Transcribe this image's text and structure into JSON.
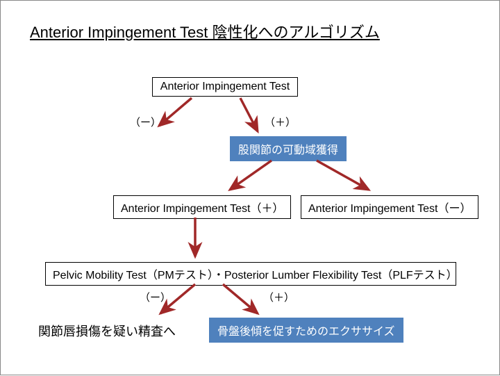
{
  "title": "Anterior Impingement Test   陰性化へのアルゴリズム",
  "nodes": {
    "n1": "Anterior Impingement Test",
    "n2": "股関節の可動域獲得",
    "n3": "Anterior Impingement Test（＋）",
    "n4": "Anterior Impingement Test（ー）",
    "n5": "Pelvic Mobility Test（PMテスト）・Posterior Lumber Flexibility Test（PLFテスト）",
    "n6": "関節唇損傷を疑い精査へ",
    "n7": "骨盤後傾を促すためのエクササイズ"
  },
  "edge_labels": {
    "e1": "（ー）",
    "e2": "（＋）",
    "e3": "（ー）",
    "e4": "（＋）"
  },
  "colors": {
    "arrow": "#a02828",
    "blue_fill": "#4f81bd"
  }
}
